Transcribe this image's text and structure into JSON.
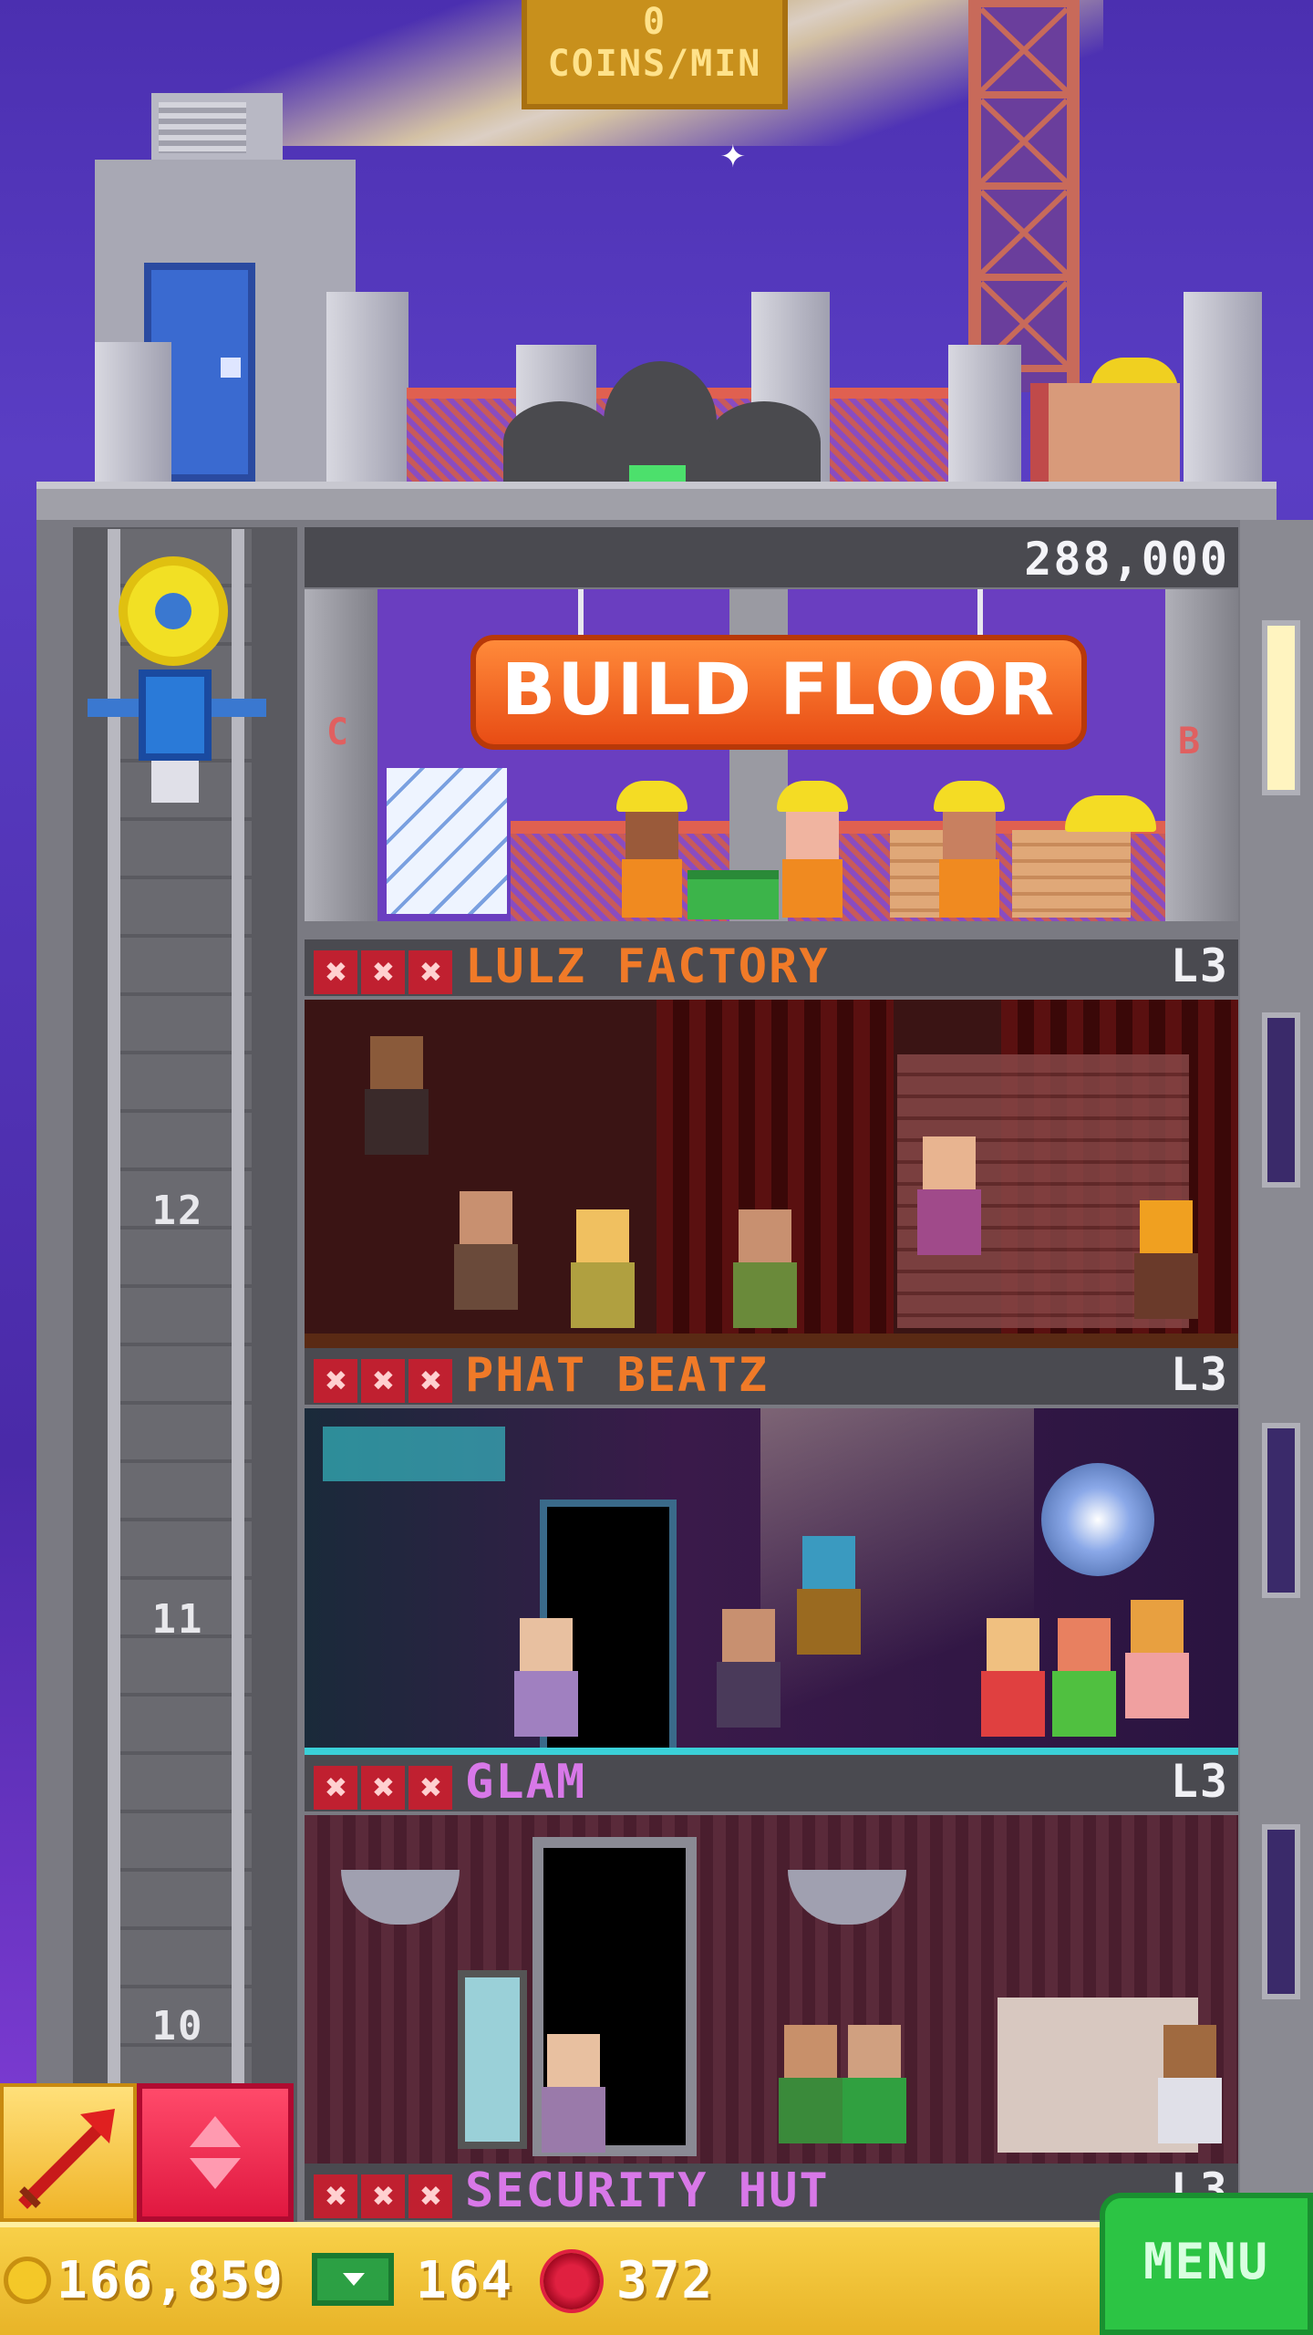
{
  "hud_top": {
    "coins_per_min_value": "0",
    "coins_per_min_label": "COINS/MIN"
  },
  "build": {
    "cost": "288,000",
    "button_label": "BUILD FLOOR",
    "left_letter": "C",
    "right_letter": "B"
  },
  "floors": [
    {
      "name": "LULZ FACTORY",
      "level": "L3",
      "name_color": "#f07a28",
      "number": "12"
    },
    {
      "name": "PHAT BEATZ",
      "level": "L3",
      "name_color": "#f07a28",
      "number": "11"
    },
    {
      "name": "GLAM",
      "level": "L3",
      "name_color": "#d878e8",
      "number": "10"
    },
    {
      "name": "SECURITY HUT",
      "level": "L3",
      "name_color": "#d878e8"
    }
  ],
  "stock_marker": "✖",
  "hud_bottom": {
    "coins": "166,859",
    "bux": "164",
    "gems": "372",
    "menu_label": "MENU"
  },
  "icons": {
    "tool": "pickaxe-arrow-icon",
    "elevator": "elevator-updown-icon",
    "coin": "coin-icon",
    "cash": "tower-bux-icon",
    "gem": "gem-icon"
  }
}
